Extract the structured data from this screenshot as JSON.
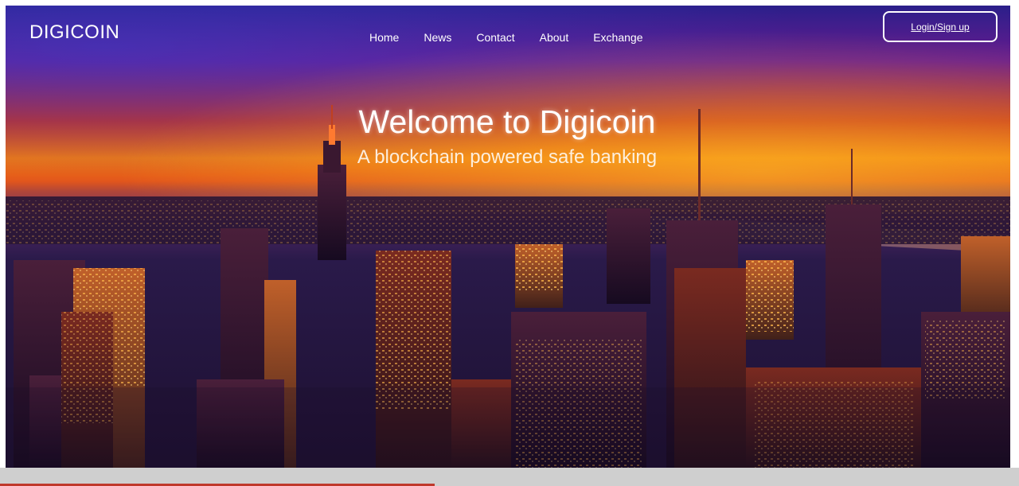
{
  "brand": {
    "name": "DIGICOIN"
  },
  "nav": {
    "items": [
      {
        "label": "Home"
      },
      {
        "label": "News"
      },
      {
        "label": "Contact"
      },
      {
        "label": "About"
      },
      {
        "label": "Exchange"
      }
    ]
  },
  "auth": {
    "login_label": "Login/Sign up"
  },
  "hero": {
    "title": "Welcome to Digicoin",
    "subtitle": "A blockchain powered safe banking",
    "image": "night-city-skyline"
  },
  "colors": {
    "sky_top": "#2a1f8a",
    "sunset": "#f07a12",
    "text": "#ffffff",
    "bottom_bar": "#cfcfcf",
    "bottom_accent": "#c0392b"
  }
}
